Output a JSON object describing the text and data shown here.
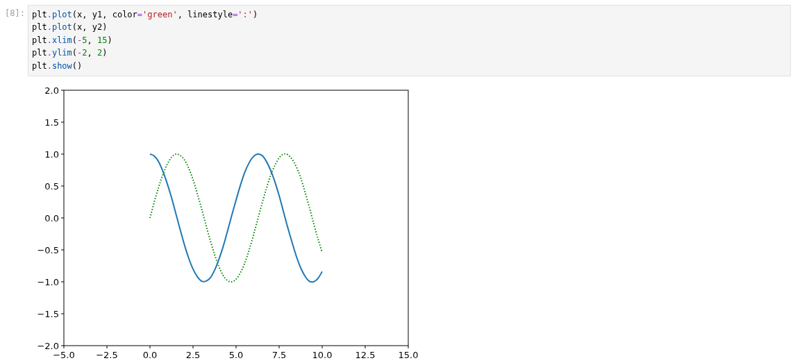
{
  "cell": {
    "prompt": "[8]:",
    "code": [
      "plt.plot(x, y1, color='green', linestyle=':')",
      "plt.plot(x, y2)",
      "plt.xlim(-5, 15)",
      "plt.ylim(-2, 2)",
      "plt.show()"
    ]
  },
  "output": {
    "chart_data": {
      "type": "line",
      "x": [
        0,
        0.25,
        0.5,
        0.75,
        1,
        1.25,
        1.5,
        1.75,
        2,
        2.25,
        2.5,
        2.75,
        3,
        3.25,
        3.5,
        3.75,
        4,
        4.25,
        4.5,
        4.75,
        5,
        5.25,
        5.5,
        5.75,
        6,
        6.25,
        6.5,
        6.75,
        7,
        7.25,
        7.5,
        7.75,
        8,
        8.25,
        8.5,
        8.75,
        9,
        9.25,
        9.5,
        9.75,
        10
      ],
      "series": [
        {
          "color": "#008000",
          "line_style": "dotted",
          "values": [
            0,
            0.25,
            0.48,
            0.68,
            0.84,
            0.95,
            1,
            0.98,
            0.91,
            0.78,
            0.6,
            0.38,
            0.14,
            -0.11,
            -0.35,
            -0.57,
            -0.76,
            -0.9,
            -0.98,
            -1,
            -0.96,
            -0.86,
            -0.71,
            -0.51,
            -0.28,
            -0.03,
            0.22,
            0.45,
            0.66,
            0.82,
            0.94,
            1,
            0.99,
            0.92,
            0.8,
            0.63,
            0.41,
            0.17,
            -0.08,
            -0.32,
            -0.54
          ]
        },
        {
          "color": "#1f77b4",
          "line_style": "solid",
          "values": [
            1,
            0.97,
            0.88,
            0.73,
            0.54,
            0.32,
            0.07,
            -0.18,
            -0.42,
            -0.63,
            -0.8,
            -0.92,
            -0.99,
            -0.99,
            -0.94,
            -0.82,
            -0.65,
            -0.45,
            -0.21,
            0.04,
            0.28,
            0.51,
            0.71,
            0.86,
            0.96,
            1,
            0.98,
            0.89,
            0.75,
            0.57,
            0.35,
            0.1,
            -0.15,
            -0.38,
            -0.6,
            -0.78,
            -0.91,
            -0.99,
            -1,
            -0.95,
            -0.84
          ]
        }
      ],
      "xlim": [
        -5,
        15
      ],
      "ylim": [
        -2,
        2
      ],
      "xticks": [
        {
          "value": -5,
          "label": "−5.0"
        },
        {
          "value": -2.5,
          "label": "−2.5"
        },
        {
          "value": 0,
          "label": "0.0"
        },
        {
          "value": 2.5,
          "label": "2.5"
        },
        {
          "value": 5,
          "label": "5.0"
        },
        {
          "value": 7.5,
          "label": "7.5"
        },
        {
          "value": 10,
          "label": "10.0"
        },
        {
          "value": 12.5,
          "label": "12.5"
        },
        {
          "value": 15,
          "label": "15.0"
        }
      ],
      "yticks": [
        {
          "value": -2,
          "label": "−2.0"
        },
        {
          "value": -1.5,
          "label": "−1.5"
        },
        {
          "value": -1,
          "label": "−1.0"
        },
        {
          "value": -0.5,
          "label": "−0.5"
        },
        {
          "value": 0,
          "label": "0.0"
        },
        {
          "value": 0.5,
          "label": "0.5"
        },
        {
          "value": 1,
          "label": "1.0"
        },
        {
          "value": 1.5,
          "label": "1.5"
        },
        {
          "value": 2,
          "label": "2.0"
        }
      ]
    }
  }
}
